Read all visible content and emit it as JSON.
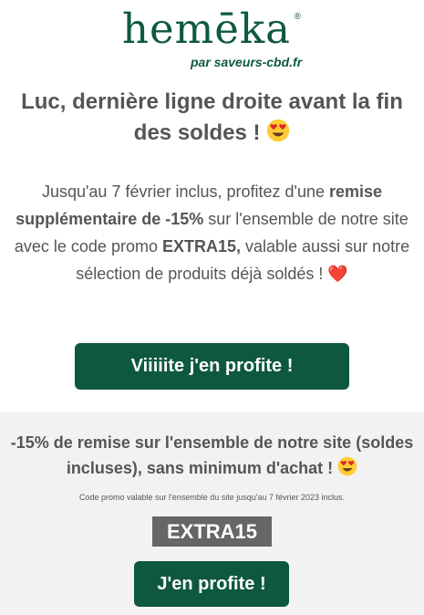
{
  "brand": {
    "logo_text": "hemēka",
    "registered_mark": "®",
    "tagline": "par saveurs-cbd.fr",
    "color": "#0d5a3c"
  },
  "headline": {
    "text": "Luc, dernière ligne droite avant la fin des soldes !",
    "emoji": "heart-eyes-emoji"
  },
  "intro": {
    "part1": "Jusqu'au 7 février inclus, profitez d'une ",
    "bold1": "remise supplémentaire de -15%",
    "part2": " sur l'ensemble de notre site avec le code promo ",
    "bold2": "EXTRA15,",
    "part3": " valable aussi sur notre sélection de produits déjà soldés !",
    "emoji": "❤️"
  },
  "main_button": {
    "label": "Viiiiite j'en profite !",
    "color": "#0e5840"
  },
  "promo_block": {
    "background": "#f2f2f2",
    "title": "-15% de remise sur l'ensemble de notre site (soldes incluses), sans minimum d'achat !",
    "title_emoji": "heart-eyes-emoji",
    "note": "Code promo valable sur l'ensemble du site jusqu'au 7 février 2023 inclus.",
    "code": "EXTRA15",
    "button_label": "J'en profite !"
  }
}
